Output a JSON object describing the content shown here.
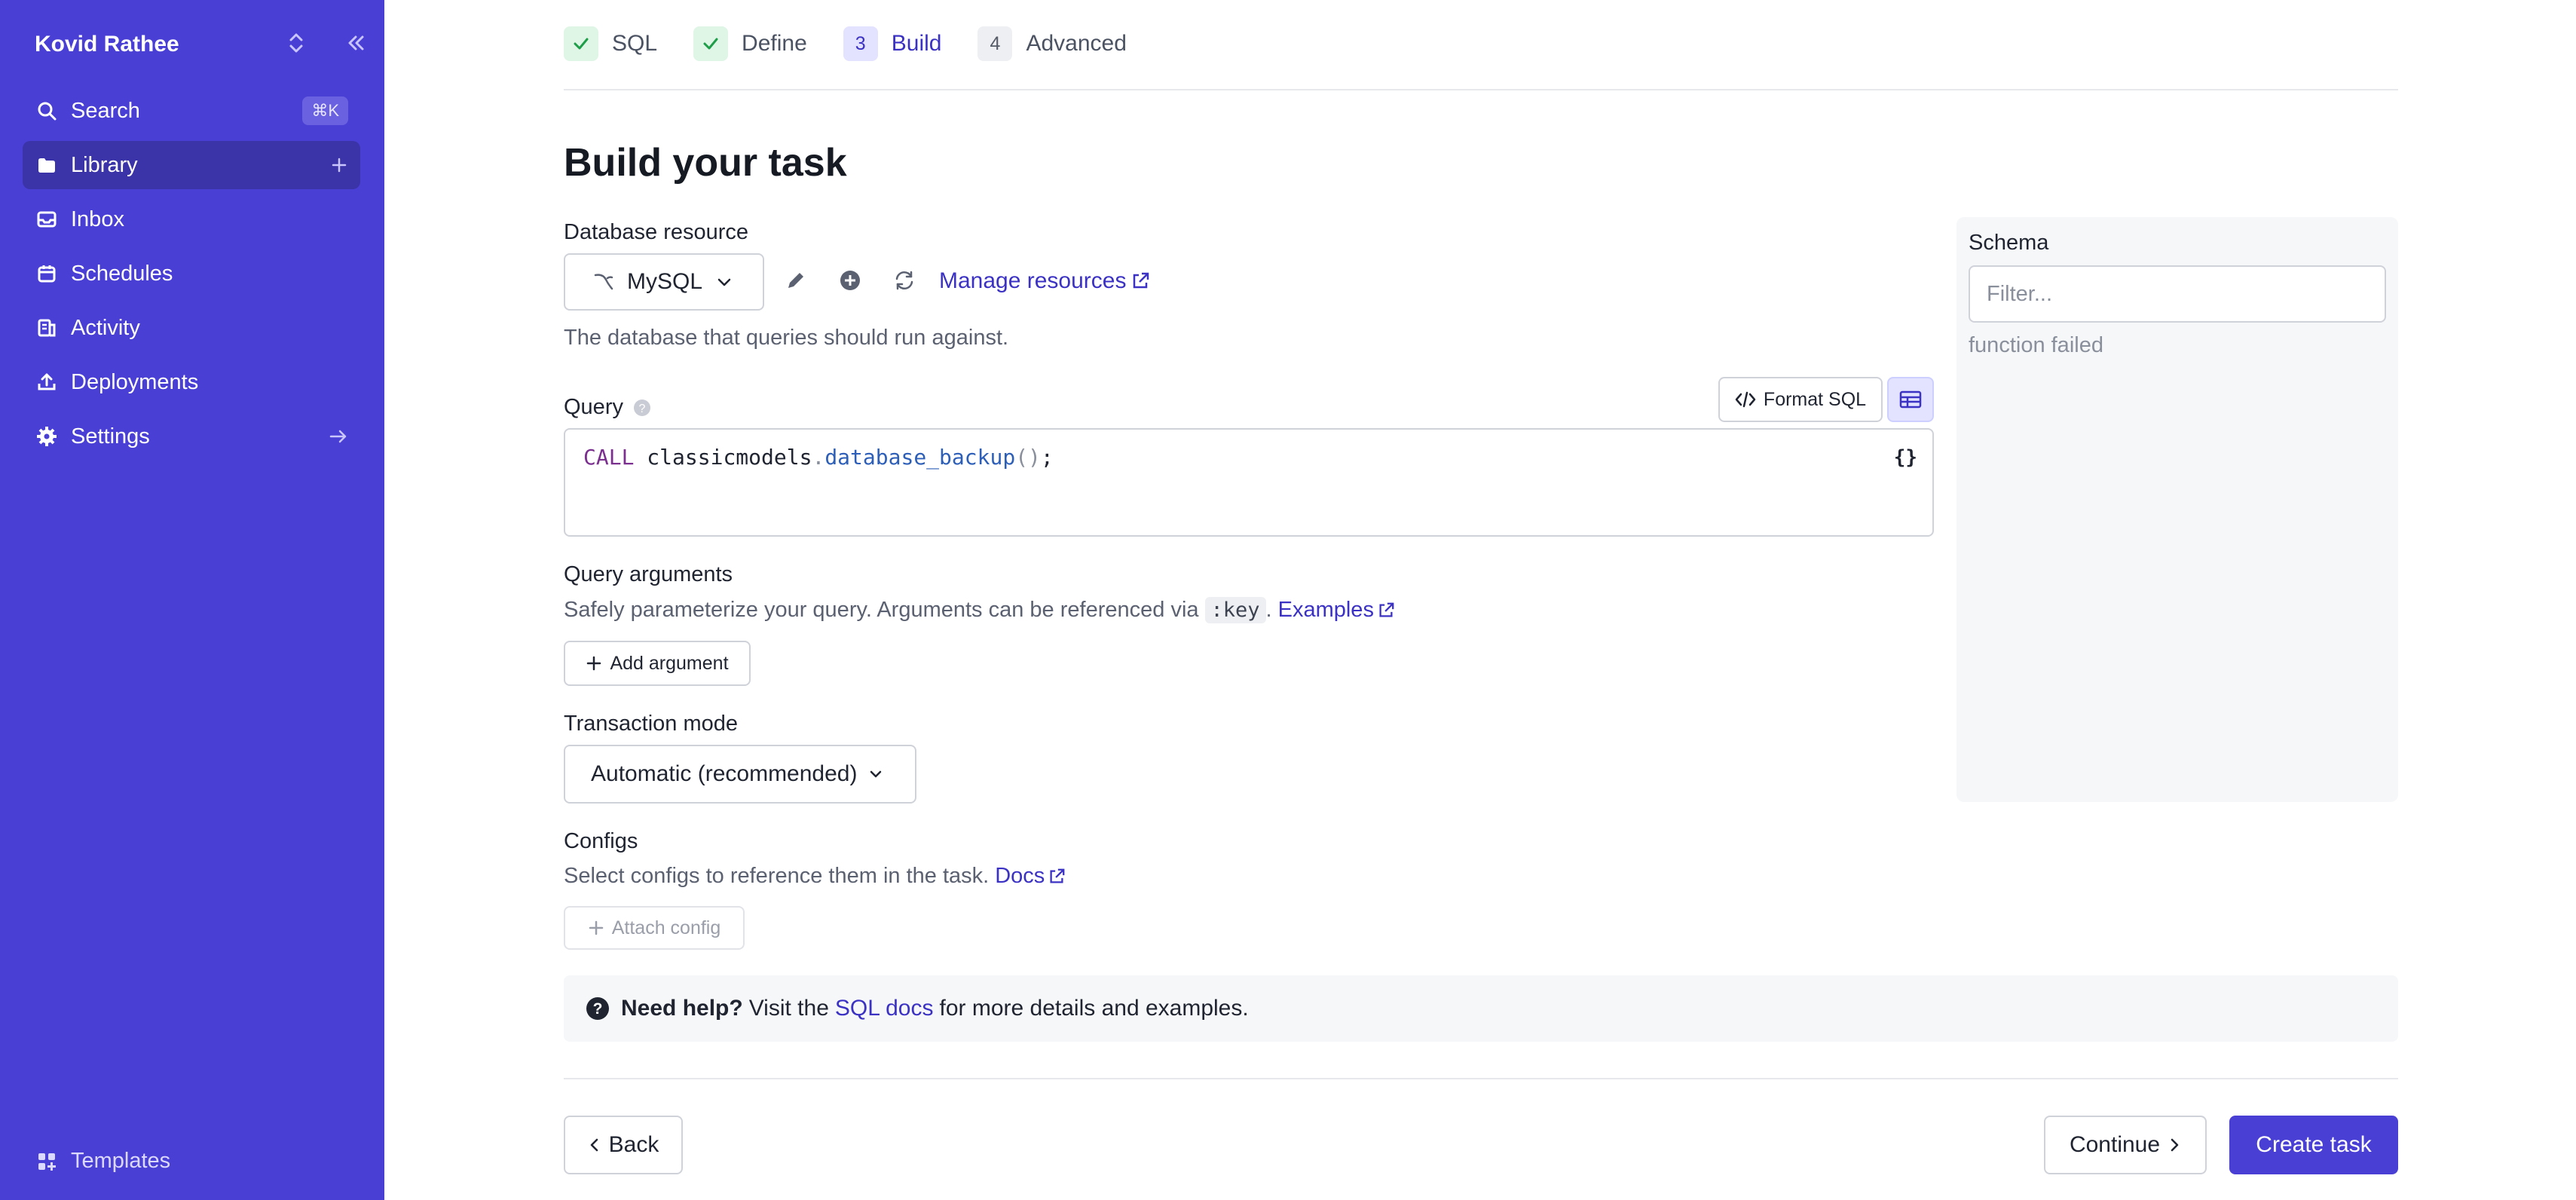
{
  "sidebar": {
    "workspace_name": "Kovid Rathee",
    "items": [
      {
        "label": "Search",
        "shortcut": "⌘K"
      },
      {
        "label": "Library"
      },
      {
        "label": "Inbox"
      },
      {
        "label": "Schedules"
      },
      {
        "label": "Activity"
      },
      {
        "label": "Deployments"
      },
      {
        "label": "Settings"
      }
    ],
    "templates_label": "Templates"
  },
  "steps": [
    {
      "label": "SQL",
      "state": "done"
    },
    {
      "label": "Define",
      "state": "done"
    },
    {
      "number": "3",
      "label": "Build",
      "state": "current"
    },
    {
      "number": "4",
      "label": "Advanced",
      "state": "todo"
    }
  ],
  "page_title": "Build your task",
  "database": {
    "label": "Database resource",
    "selected": "MySQL",
    "manage_link": "Manage resources",
    "help": "The database that queries should run against."
  },
  "query": {
    "label": "Query",
    "format_button": "Format SQL",
    "code_keyword": "CALL",
    "code_schema": "classicmodels",
    "code_dot": ".",
    "code_fn": "database_backup",
    "code_parens": "()",
    "code_end": ";"
  },
  "arguments": {
    "label": "Query arguments",
    "help": "Safely parameterize your query. Arguments can be referenced via",
    "key_tag": ":key",
    "period": ".",
    "examples_link": "Examples",
    "add_button": "Add argument"
  },
  "transaction": {
    "label": "Transaction mode",
    "selected": "Automatic (recommended)"
  },
  "configs": {
    "label": "Configs",
    "help": "Select configs to reference them in the task.",
    "docs_link": "Docs",
    "attach_button": "Attach config"
  },
  "help_banner": {
    "bold": "Need help?",
    "pre": "Visit the",
    "link": "SQL docs",
    "post": "for more details and examples."
  },
  "schema": {
    "title": "Schema",
    "filter_placeholder": "Filter...",
    "error": "function failed"
  },
  "footer": {
    "back": "Back",
    "continue": "Continue",
    "create": "Create task"
  },
  "colors": {
    "sidebar": "#4a3fd4",
    "accent": "#3b32c4",
    "success": "#1f9e4a"
  }
}
